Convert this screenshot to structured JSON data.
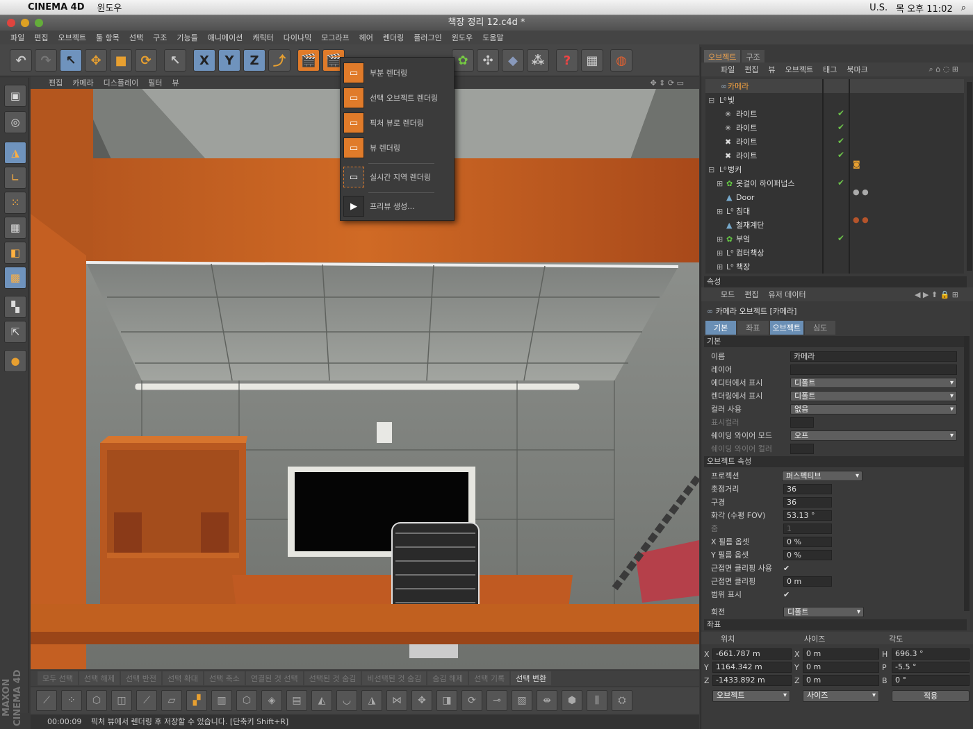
{
  "menubar": {
    "app": "CINEMA 4D",
    "window_menu": "윈도우",
    "locale": "U.S.",
    "clock": "목 오후 11:02"
  },
  "window": {
    "title": "책장 정리 12.c4d *"
  },
  "mainmenu": [
    "파일",
    "편집",
    "오브젝트",
    "툴 항목",
    "선택",
    "구조",
    "기능들",
    "애니메이션",
    "캐릭터",
    "다이나믹",
    "모그라프",
    "헤어",
    "렌더링",
    "플러그인",
    "윈도우",
    "도움말"
  ],
  "toolbar_axes": [
    "X",
    "Y",
    "Z"
  ],
  "viewport": {
    "menu": [
      "편집",
      "카메라",
      "디스플레이",
      "필터",
      "뷰"
    ]
  },
  "render_menu": {
    "items": [
      "부분 렌더링",
      "선택 오브젝트 렌더링",
      "픽처 뷰로 렌더링",
      "뷰 렌더링",
      "실시간 지역 렌더링",
      "프리뷰 생성..."
    ]
  },
  "selection_bar": [
    "모두 선택",
    "선택 해제",
    "선택 반전",
    "선택 확대",
    "선택 축소",
    "연결된 것 선택",
    "선택된 것 숨김",
    "비선택된 것 숨김",
    "숨김 해제",
    "선택 기록",
    "선택 변환"
  ],
  "status": {
    "time": "00:00:09",
    "message": "픽처 뷰에서 렌더링 후 저장할 수 있습니다. [단축키 Shift+R]"
  },
  "object_manager": {
    "tabs": [
      "오브젝트",
      "구조"
    ],
    "menu": [
      "파일",
      "편집",
      "뷰",
      "오브젝트",
      "태그",
      "북마크"
    ],
    "objects": [
      {
        "name": "카메라",
        "selected": true
      },
      {
        "name": "빛"
      },
      {
        "name": "라이트"
      },
      {
        "name": "라이트"
      },
      {
        "name": "라이트"
      },
      {
        "name": "라이트"
      },
      {
        "name": "벙커"
      },
      {
        "name": "옷걸이 하이퍼넙스"
      },
      {
        "name": "Door"
      },
      {
        "name": "침대"
      },
      {
        "name": "철재계단"
      },
      {
        "name": "부엌"
      },
      {
        "name": "컴터책상"
      },
      {
        "name": "책장"
      }
    ]
  },
  "attributes": {
    "header": "속성",
    "menu": [
      "모드",
      "편집",
      "유저 데이터"
    ],
    "object_title": "카메라 오브젝트 [카메라]",
    "tabs": [
      "기본",
      "좌표",
      "오브젝트",
      "심도"
    ],
    "section_basic": "기본",
    "basic": {
      "name_label": "이름",
      "name_value": "카메라",
      "layer_label": "레이어",
      "editor_vis_label": "에디터에서 표시",
      "editor_vis_value": "디폴트",
      "render_vis_label": "렌더링에서 표시",
      "render_vis_value": "디폴트",
      "color_use_label": "컬러 사용",
      "color_use_value": "없음",
      "display_color_label": "표시컬러",
      "shading_wire_label": "쉐이딩 와이어 모드",
      "shading_wire_value": "오프",
      "wire_color_label": "쉐이딩 와이어 컬러"
    },
    "section_object": "오브젝트 속성",
    "object": {
      "projection_label": "프로젝션",
      "projection_value": "퍼스펙티브",
      "focal_label": "촛점거리",
      "focal_value": "36",
      "aperture_label": "구경",
      "aperture_value": "36",
      "fov_label": "화각 (수평 FOV)",
      "fov_value": "53.13 °",
      "zoom_label": "줌",
      "zoom_value": "1",
      "xoff_label": "X 필름 옵셋",
      "xoff_value": "0 %",
      "yoff_label": "Y 필름 옵셋",
      "yoff_value": "0 %",
      "nearclip_use_label": "근접면 클리핑 사용",
      "nearclip_label": "근접면 클리핑",
      "nearclip_value": "0 m",
      "range_label": "범위 표시",
      "rotation_label": "회전",
      "rotation_value": "디폴트"
    }
  },
  "coordinates": {
    "header": "좌표",
    "col_position": "위치",
    "col_size": "사이즈",
    "col_angle": "각도",
    "position": {
      "X": "-661.787 m",
      "Y": "1164.342 m",
      "Z": "-1433.892 m"
    },
    "size": {
      "X": "0 m",
      "Y": "0 m",
      "Z": "0 m"
    },
    "angle": {
      "H": "696.3 °",
      "P": "-5.5 °",
      "B": "0 °"
    },
    "mode_value": "오브젝트",
    "size_mode_value": "사이즈",
    "apply_label": "적용"
  }
}
